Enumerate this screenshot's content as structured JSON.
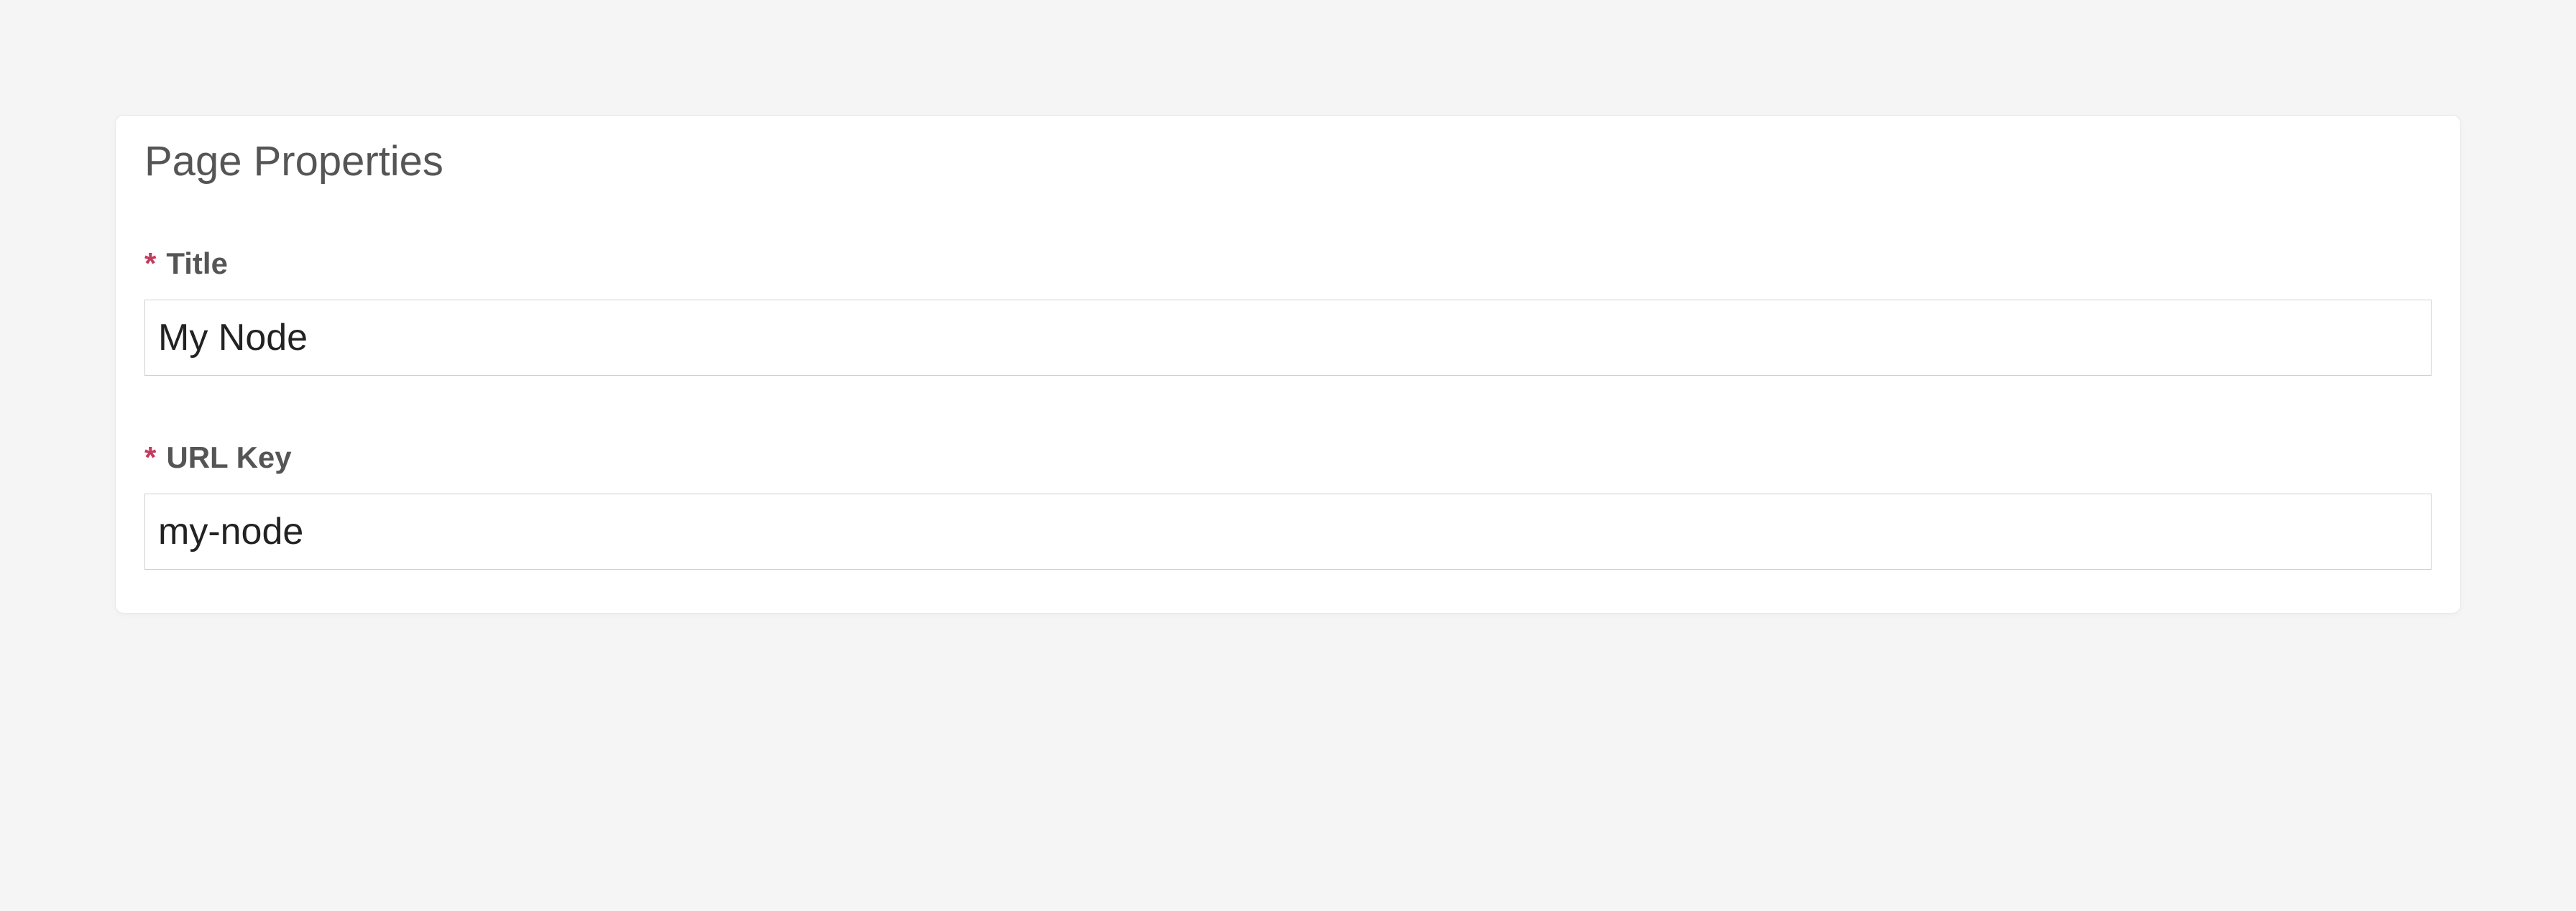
{
  "panel": {
    "heading": "Page Properties",
    "fields": {
      "title": {
        "label": "Title",
        "required_mark": "*",
        "value": "My Node"
      },
      "url_key": {
        "label": "URL Key",
        "required_mark": "*",
        "value": "my-node"
      }
    }
  }
}
